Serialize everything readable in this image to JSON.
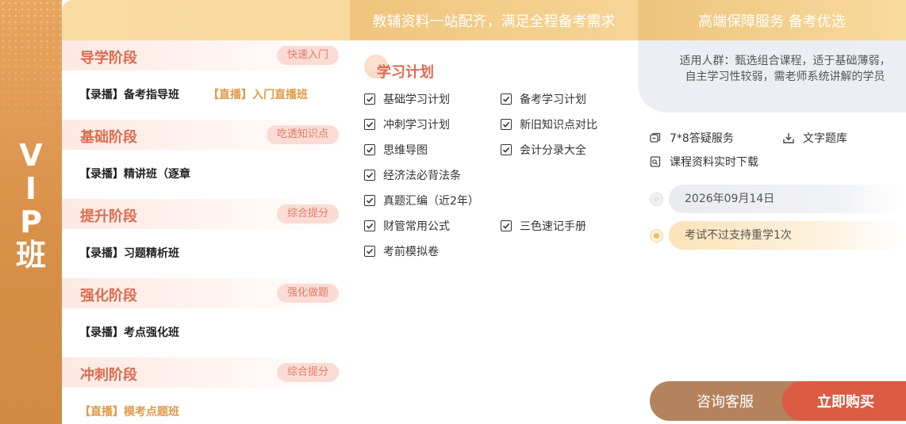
{
  "vip": {
    "letters": [
      "V",
      "I",
      "P",
      "班"
    ]
  },
  "header": {
    "mid_title": "教辅资料一站配齐，满足全程备考需求",
    "right_title": "高端保障服务 备考优选"
  },
  "stages": [
    {
      "title": "导学阶段",
      "tag": "快速入门",
      "courses": [
        {
          "label": "【录播】备考指导班",
          "live": false
        },
        {
          "label": "【直播】入门直播班",
          "live": true
        }
      ]
    },
    {
      "title": "基础阶段",
      "tag": "吃透知识点",
      "courses": [
        {
          "label": "【录播】精讲班（逐章",
          "live": false
        }
      ]
    },
    {
      "title": "提升阶段",
      "tag": "综合提分",
      "courses": [
        {
          "label": "【录播】习题精析班",
          "live": false
        }
      ]
    },
    {
      "title": "强化阶段",
      "tag": "强化做题",
      "courses": [
        {
          "label": "【录播】考点强化班",
          "live": false
        }
      ]
    },
    {
      "title": "冲刺阶段",
      "tag": "综合提分",
      "courses": [
        {
          "label": "【直播】模考点题班",
          "live": true
        }
      ]
    }
  ],
  "plan": {
    "title": "学习计划",
    "items_left": [
      "基础学习计划",
      "冲刺学习计划",
      "思维导图",
      "经济法必背法条",
      "真题汇编（近2年）",
      "财管常用公式",
      "考前模拟卷"
    ],
    "items_right": [
      "备考学习计划",
      "新旧知识点对比",
      "会计分录大全",
      "三色速记手册"
    ]
  },
  "target": {
    "text": "适用人群：甄选组合课程，适于基础薄弱，自主学习性较弱，需老师系统讲解的学员"
  },
  "services": [
    {
      "label": "7*8答疑服务",
      "icon": "support-icon"
    },
    {
      "label": "文字题库",
      "icon": "download-icon"
    },
    {
      "label": "课程资料实时下载",
      "icon": "document-icon"
    }
  ],
  "timeline": {
    "date": "2026年09月14日",
    "guarantee": "考试不过支持重学1次"
  },
  "buttons": {
    "consult": "咨询客服",
    "buy": "立即购买"
  },
  "colors": {
    "accent_red": "#df6a4e",
    "gold": "#e09a48",
    "buy": "#dc5b45",
    "consult": "#b5825e"
  }
}
